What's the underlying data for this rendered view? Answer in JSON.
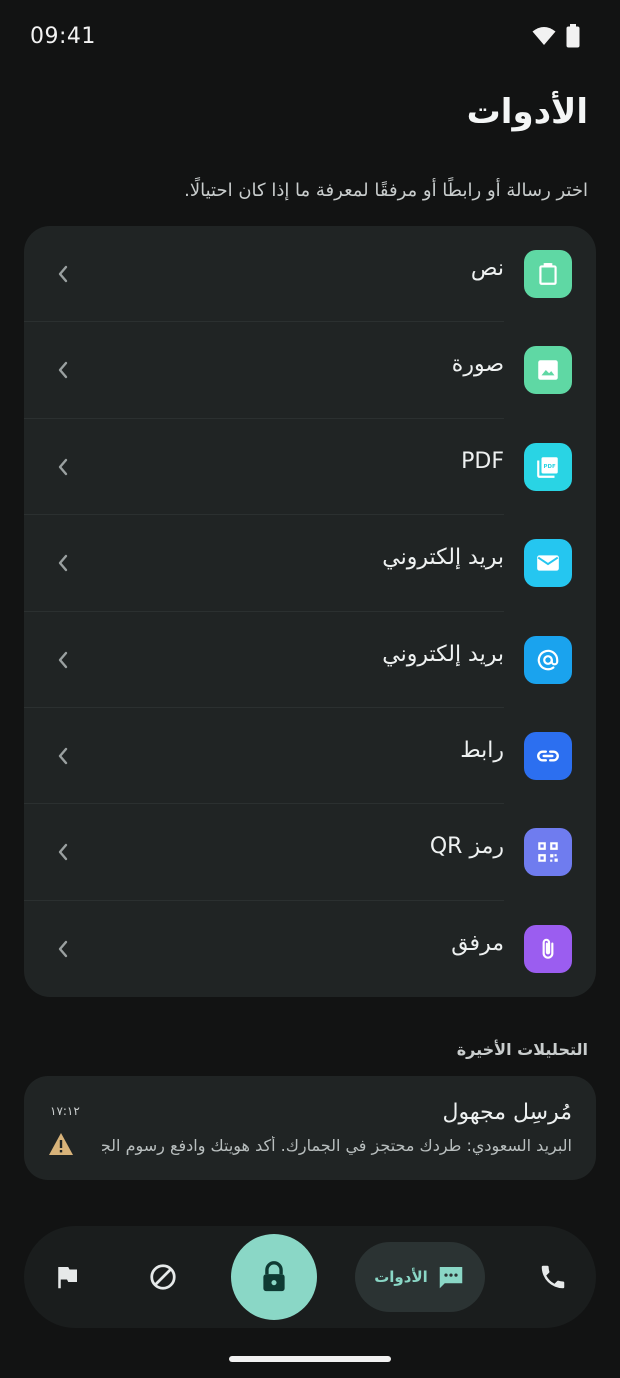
{
  "status_bar": {
    "time": "09:41"
  },
  "header": {
    "title": "الأدوات",
    "subtitle": "اختر رسالة أو رابطًا أو مرفقًا لمعرفة ما إذا كان احتيالًا."
  },
  "tools": [
    {
      "label": "نص",
      "icon": "clipboard-icon",
      "color": "#5fd8a4"
    },
    {
      "label": "صورة",
      "icon": "image-icon",
      "color": "#5fd8a4"
    },
    {
      "label": "PDF",
      "icon": "pdf-icon",
      "color": "#29d4e4"
    },
    {
      "label": "بريد إلكتروني",
      "icon": "mail-icon",
      "color": "#25c6f0"
    },
    {
      "label": "بريد إلكتروني",
      "icon": "at-icon",
      "color": "#1aa3ee"
    },
    {
      "label": "رابط",
      "icon": "link-icon",
      "color": "#2c6ff0"
    },
    {
      "label": "رمز QR",
      "icon": "qr-icon",
      "color": "#6f7cef"
    },
    {
      "label": "مرفق",
      "icon": "paperclip-icon",
      "color": "#9b5df0"
    }
  ],
  "recent": {
    "title": "التحليلات الأخيرة",
    "items": [
      {
        "sender": "مُرسِل مجهول",
        "time": "١٧:١٢",
        "snippet": "البريد السعودي: طردك محتجز في الجمارك. أكد هويتك وادفع رسوم الجمر..."
      }
    ]
  },
  "bottom_nav": {
    "tools_label": "الأدوات",
    "accent": "#8ad7c6"
  }
}
